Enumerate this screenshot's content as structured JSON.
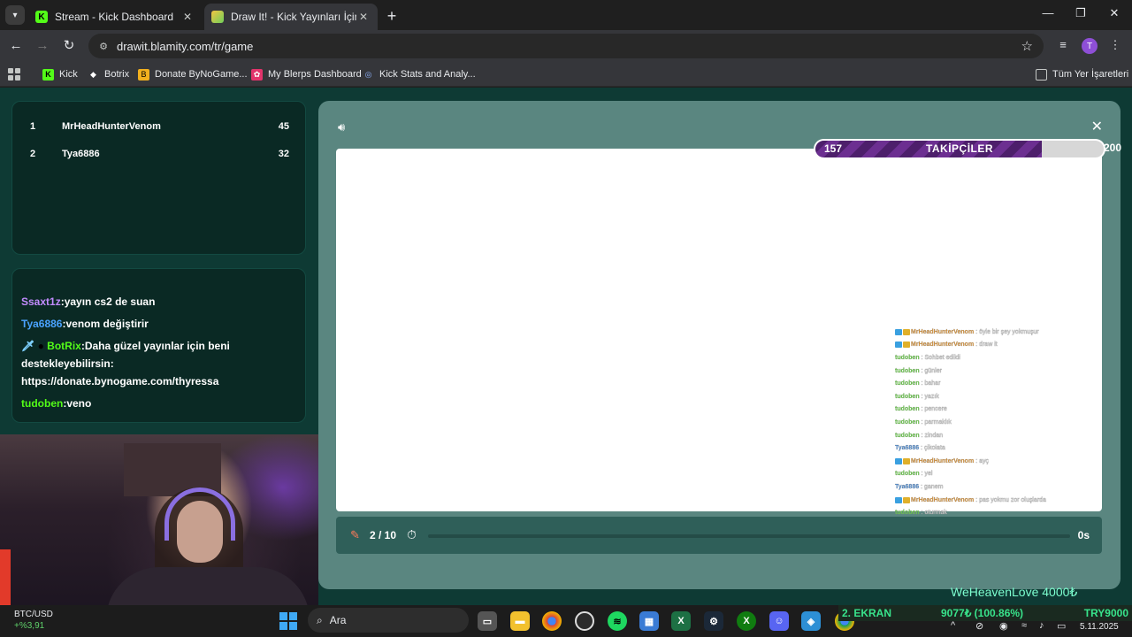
{
  "browser": {
    "tabs": [
      {
        "title": "Stream - Kick Dashboard",
        "active": false
      },
      {
        "title": "Draw It! - Kick Yayınları İçin Çizim",
        "active": true
      }
    ],
    "url": "drawit.blamity.com/tr/game",
    "profile_initial": "T",
    "bookmarks": [
      {
        "label": "Kick"
      },
      {
        "label": "Botrix"
      },
      {
        "label": "Donate ByNoGame..."
      },
      {
        "label": "My Blerps Dashboard"
      },
      {
        "label": "Kick Stats and Analy..."
      }
    ],
    "all_bookmarks": "Tüm Yer İşaretleri"
  },
  "leaderboard": [
    {
      "rank": "1",
      "name": "MrHeadHunterVenom",
      "score": "45"
    },
    {
      "rank": "2",
      "name": "Tya6886",
      "score": "32"
    }
  ],
  "chat": [
    {
      "user": "Ssaxt1z",
      "color": "#c38cff",
      "text": ":yayın cs2 de suan"
    },
    {
      "user": "Tya6886",
      "color": "#4aa3ff",
      "text": ":venom değiştirir"
    },
    {
      "user": "BotRix",
      "color": "#53fc18",
      "text": ":Daha güzel yayınlar için beni destekleyebilirsin: https://donate.bynogame.com/thyressa"
    },
    {
      "user": "tudoben",
      "color": "#53fc18",
      "text": ":veno"
    }
  ],
  "game": {
    "followers_label": "TAKİPÇİLER",
    "followers_current": "157",
    "followers_goal": "200",
    "followers_progress": 0.785,
    "round": "2 / 10",
    "timer": "0s",
    "timer_progress": 0
  },
  "overlay_chat": [
    {
      "user": "MrHeadHunterVenom",
      "color": "#e0912a",
      "badges": true,
      "text": ": öyle bir şey yokmuşur"
    },
    {
      "user": "MrHeadHunterVenom",
      "color": "#e0912a",
      "badges": true,
      "text": ": draw it"
    },
    {
      "user": "tudoben",
      "color": "#5fd33a",
      "badges": false,
      "text": ": Sohbet edildi"
    },
    {
      "user": "tudoben",
      "color": "#5fd33a",
      "badges": false,
      "text": ": günler"
    },
    {
      "user": "tudoben",
      "color": "#5fd33a",
      "badges": false,
      "text": ": bahar"
    },
    {
      "user": "tudoben",
      "color": "#5fd33a",
      "badges": false,
      "text": ": yazık"
    },
    {
      "user": "tudoben",
      "color": "#5fd33a",
      "badges": false,
      "text": ": pencere"
    },
    {
      "user": "tudoben",
      "color": "#5fd33a",
      "badges": false,
      "text": ": parmaklık"
    },
    {
      "user": "tudoben",
      "color": "#5fd33a",
      "badges": false,
      "text": ": zindan"
    },
    {
      "user": "Tya6886",
      "color": "#3f86d6",
      "badges": false,
      "text": ": çikolata"
    },
    {
      "user": "MrHeadHunterVenom",
      "color": "#e0912a",
      "badges": true,
      "text": ": ayç"
    },
    {
      "user": "tudoben",
      "color": "#5fd33a",
      "badges": false,
      "text": ": yel"
    },
    {
      "user": "Tya6886",
      "color": "#3f86d6",
      "badges": false,
      "text": ": ganem"
    },
    {
      "user": "MrHeadHunterVenom",
      "color": "#e0912a",
      "badges": true,
      "text": ": pas yokmu zor oluşlarda"
    },
    {
      "user": "tudoben",
      "color": "#5fd33a",
      "badges": false,
      "text": ": oturmak"
    }
  ],
  "stream_overlay": {
    "donation": "WeHeavenLove 4000₺",
    "ticker_screen": "2. EKRAN",
    "ticker_amount": "9077₺ (100.86%)",
    "ticker_goal": "TRY9000"
  },
  "taskbar": {
    "weather_title": "BTC/USD",
    "weather_change": "+%3,91",
    "search_placeholder": "Ara",
    "date": "5.11.2025",
    "apps": [
      "file-explorer",
      "chrome",
      "obs",
      "spotify",
      "store",
      "excel",
      "steam",
      "xbox",
      "discord",
      "kodi",
      "chrome-active"
    ]
  }
}
